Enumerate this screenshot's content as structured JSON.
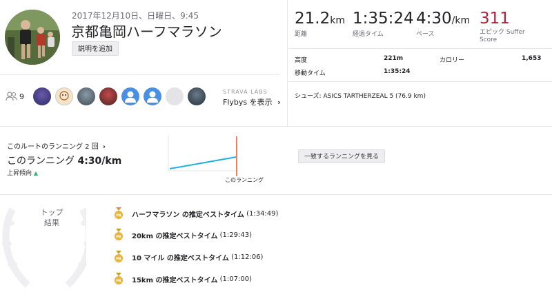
{
  "activity": {
    "date": "2017年12月10日、日曜日、9:45",
    "title": "京都亀岡ハーフマラソン",
    "add_description_label": "説明を追加"
  },
  "athletes": {
    "count": "9",
    "strava_labs": "STRAVA LABS",
    "flybys_label": "Flybys を表示"
  },
  "stats": {
    "distance": {
      "value": "21.2",
      "unit": "km",
      "label": "距離"
    },
    "moving_time": {
      "value": "1:35:24",
      "label": "経過タイム"
    },
    "pace": {
      "value": "4:30",
      "unit": "/km",
      "label": "ペース"
    },
    "suffer_score": {
      "value": "311",
      "label_line1": "エピック Suffer",
      "label_line2": "Score"
    }
  },
  "details": {
    "elevation_label": "高度",
    "elevation_value": "221m",
    "calories_label": "カロリー",
    "calories_value": "1,653",
    "moving_time_label": "移動タイム",
    "moving_time_value": "1:35:24",
    "shoes_text": "シューズ: ASICS TARTHERZEAL 5 (76.9 km)"
  },
  "route": {
    "link_text": "このルートのランニング 2 回",
    "pace_label": "このランニング",
    "pace_value": "4:30/km",
    "trend_text": "上昇傾向",
    "this_run_label": "このランニング",
    "match_button": "一致するランニングを見る"
  },
  "top_results": {
    "title_line1": "トップ",
    "title_line2": "結果",
    "items": [
      {
        "name": "ハーフマラソン の推定ベストタイム",
        "time": "(1:34:49)"
      },
      {
        "name": "20km の推定ベストタイム",
        "time": "(1:29:43)"
      },
      {
        "name": "10 マイル の推定ベストタイム",
        "time": "(1:12:06)"
      },
      {
        "name": "15km の推定ベストタイム",
        "time": "(1:07:00)"
      }
    ]
  },
  "colors": {
    "suffer": "#b0213a",
    "trend_line": "#1eaee6",
    "this_run_marker": "#e8572e",
    "medal": "#e8b43c"
  },
  "icons": {
    "people": "people-icon",
    "chevron": "chevron-right-icon",
    "medal": "medal-icon",
    "trend": "up-triangle-icon"
  }
}
